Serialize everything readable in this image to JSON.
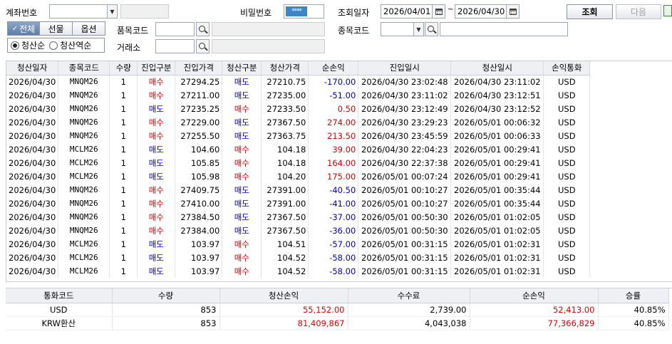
{
  "toolbar": {
    "account_label": "계좌번호",
    "account_value": "",
    "password_label": "비밀번호",
    "password_mask": "****",
    "query_date_label": "조회일자",
    "date_from": "2026/04/01",
    "date_sep": "~",
    "date_to": "2026/04/30",
    "query_button": "조회",
    "next_button": "다음",
    "filter_tabs": [
      {
        "label": "전체",
        "checked": true
      },
      {
        "label": "선물"
      },
      {
        "label": "옵션"
      }
    ],
    "product_code_label": "품목코드",
    "symbol_code_label": "종목코드",
    "exchange_label": "거래소",
    "sort_options": [
      {
        "label": "청산순",
        "selected": true
      },
      {
        "label": "청산역순",
        "selected": false
      }
    ]
  },
  "columns": [
    "청산일자",
    "종목코드",
    "수량",
    "진입구분",
    "진입가격",
    "청산구분",
    "청산가격",
    "순손익",
    "진입일시",
    "청산일시",
    "손익통화"
  ],
  "rows": [
    [
      "2026/04/30",
      "MNQM26",
      "1",
      "매수",
      "27294.25",
      "매도",
      "27210.75",
      "-170.00",
      "2026/04/30 23:02:48",
      "2026/04/30 23:11:02",
      "USD"
    ],
    [
      "2026/04/30",
      "MNQM26",
      "1",
      "매수",
      "27211.00",
      "매도",
      "27235.00",
      "-51.00",
      "2026/04/30 23:11:02",
      "2026/04/30 23:12:51",
      "USD"
    ],
    [
      "2026/04/30",
      "MNQM26",
      "1",
      "매도",
      "27235.25",
      "매수",
      "27233.50",
      "0.50",
      "2026/04/30 23:12:49",
      "2026/04/30 23:12:52",
      "USD"
    ],
    [
      "2026/04/30",
      "MNQM26",
      "1",
      "매수",
      "27229.00",
      "매도",
      "27367.50",
      "274.00",
      "2026/04/30 23:29:23",
      "2026/05/01 00:06:32",
      "USD"
    ],
    [
      "2026/04/30",
      "MNQM26",
      "1",
      "매수",
      "27255.50",
      "매도",
      "27363.75",
      "213.50",
      "2026/04/30 23:45:59",
      "2026/05/01 00:06:33",
      "USD"
    ],
    [
      "2026/04/30",
      "MCLM26",
      "1",
      "매도",
      "104.60",
      "매수",
      "104.18",
      "39.00",
      "2026/04/30 22:04:23",
      "2026/05/01 00:29:41",
      "USD"
    ],
    [
      "2026/04/30",
      "MCLM26",
      "1",
      "매도",
      "105.85",
      "매수",
      "104.18",
      "164.00",
      "2026/04/30 22:37:38",
      "2026/05/01 00:29:41",
      "USD"
    ],
    [
      "2026/04/30",
      "MCLM26",
      "1",
      "매도",
      "105.98",
      "매수",
      "104.20",
      "175.00",
      "2026/05/01 00:07:24",
      "2026/05/01 00:29:41",
      "USD"
    ],
    [
      "2026/04/30",
      "MNQM26",
      "1",
      "매수",
      "27409.75",
      "매도",
      "27391.00",
      "-40.50",
      "2026/05/01 00:10:27",
      "2026/05/01 00:35:44",
      "USD"
    ],
    [
      "2026/04/30",
      "MNQM26",
      "1",
      "매수",
      "27410.00",
      "매도",
      "27391.00",
      "-41.00",
      "2026/05/01 00:10:27",
      "2026/05/01 00:35:44",
      "USD"
    ],
    [
      "2026/04/30",
      "MNQM26",
      "1",
      "매수",
      "27384.50",
      "매도",
      "27367.50",
      "-37.00",
      "2026/05/01 00:50:30",
      "2026/05/01 01:02:05",
      "USD"
    ],
    [
      "2026/04/30",
      "MNQM26",
      "1",
      "매수",
      "27384.00",
      "매도",
      "27367.50",
      "-36.00",
      "2026/05/01 00:50:30",
      "2026/05/01 01:02:05",
      "USD"
    ],
    [
      "2026/04/30",
      "MCLM26",
      "1",
      "매도",
      "103.97",
      "매수",
      "104.51",
      "-57.00",
      "2026/05/01 00:31:15",
      "2026/05/01 01:02:31",
      "USD"
    ],
    [
      "2026/04/30",
      "MCLM26",
      "1",
      "매도",
      "103.97",
      "매수",
      "104.52",
      "-58.00",
      "2026/05/01 00:31:15",
      "2026/05/01 01:02:31",
      "USD"
    ],
    [
      "2026/04/30",
      "MCLM26",
      "1",
      "매도",
      "103.97",
      "매수",
      "104.52",
      "-58.00",
      "2026/05/01 00:31:15",
      "2026/05/01 01:02:31",
      "USD"
    ]
  ],
  "summary_columns": [
    "통화코드",
    "수량",
    "청산손익",
    "수수료",
    "순손익",
    "승률"
  ],
  "summary_rows": [
    [
      "USD",
      "853",
      "55,152.00",
      "2,739.00",
      "52,413.00",
      "40.85%"
    ],
    [
      "KRW환산",
      "853",
      "81,409,867",
      "4,043,038",
      "77,366,829",
      "40.85%"
    ]
  ],
  "colors": {
    "buy": "#e00000",
    "sell": "#0000c8",
    "profit": "#e00000",
    "loss": "#0000c8"
  }
}
